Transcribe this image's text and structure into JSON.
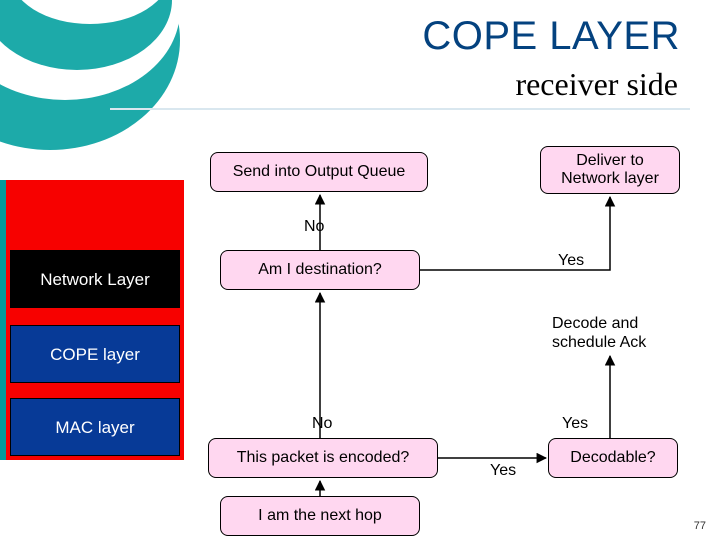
{
  "title": "COPE LAYER",
  "subtitle": "receiver side",
  "layers": {
    "network": "Network Layer",
    "cope": "COPE layer",
    "mac": "MAC layer"
  },
  "nodes": {
    "output_queue": "Send into Output Queue",
    "deliver": "Deliver to Network layer",
    "am_dest": "Am I destination?",
    "encoded": "This packet is encoded?",
    "next_hop": "I am the next hop",
    "decodable": "Decodable?"
  },
  "labels": {
    "no_top": "No",
    "yes_dest": "Yes",
    "decode_ack": "Decode and schedule Ack",
    "no_enc": "No",
    "yes_enc": "Yes",
    "yes_mid": "Yes"
  },
  "page": "77",
  "chart_data": {
    "type": "area",
    "title": "COPE LAYER – receiver side (flowchart)",
    "nodes": [
      {
        "id": "next_hop",
        "label": "I am the next hop"
      },
      {
        "id": "encoded",
        "label": "This packet is encoded?"
      },
      {
        "id": "decodable",
        "label": "Decodable?"
      },
      {
        "id": "decode_ack",
        "label": "Decode and schedule Ack"
      },
      {
        "id": "am_dest",
        "label": "Am I destination?"
      },
      {
        "id": "deliver",
        "label": "Deliver to Network layer"
      },
      {
        "id": "output_q",
        "label": "Send into Output Queue"
      }
    ],
    "edges": [
      {
        "from": "next_hop",
        "to": "encoded",
        "label": ""
      },
      {
        "from": "encoded",
        "to": "am_dest",
        "label": "No"
      },
      {
        "from": "encoded",
        "to": "decodable",
        "label": "Yes"
      },
      {
        "from": "decodable",
        "to": "decode_ack",
        "label": "Yes"
      },
      {
        "from": "decode_ack",
        "to": "am_dest",
        "label": ""
      },
      {
        "from": "am_dest",
        "to": "deliver",
        "label": "Yes"
      },
      {
        "from": "am_dest",
        "to": "output_q",
        "label": "No"
      }
    ],
    "layers": [
      "Network Layer",
      "COPE layer",
      "MAC layer"
    ]
  }
}
